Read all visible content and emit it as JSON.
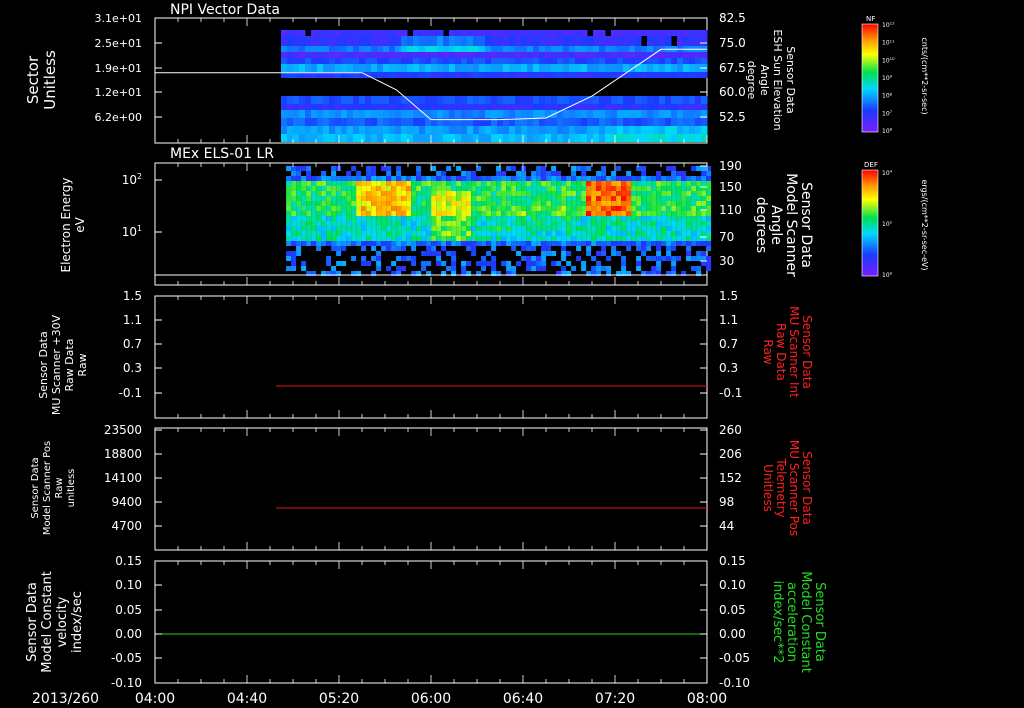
{
  "time_axis": {
    "date_label": "2013/260",
    "ticks": [
      "04:00",
      "04:40",
      "05:20",
      "06:00",
      "06:40",
      "07:20",
      "08:00"
    ],
    "range_minutes": [
      240,
      480
    ]
  },
  "panels": [
    {
      "id": "npi",
      "title": "NPI Vector Data",
      "left_label": [
        "Sector",
        "Unitless"
      ],
      "left_ticks": [
        "3.1e+01",
        "2.5e+01",
        "1.9e+01",
        "1.2e+01",
        "6.2e+00"
      ],
      "right_label": [
        "Sensor Data",
        "ESH Sun Elevation",
        "Angle",
        "degree"
      ],
      "right_ticks": [
        "82.5",
        "75.0",
        "67.5",
        "60.0",
        "52.5"
      ],
      "right_color": "#ffffff"
    },
    {
      "id": "els",
      "title": "MEx ELS-01 LR",
      "left_label": [
        "Electron Energy",
        "eV"
      ],
      "left_ticks": [
        "10",
        "10",
        "",
        ""
      ],
      "left_log_ticks": [
        {
          "base": "10",
          "exp": "2"
        },
        {
          "base": "10",
          "exp": "1"
        }
      ],
      "right_label": [
        "Sensor Data",
        "Model Scanner",
        "Angle",
        "degrees"
      ],
      "right_ticks": [
        "190",
        "150",
        "110",
        "70",
        "30"
      ],
      "right_color": "#ffffff"
    },
    {
      "id": "mu_int",
      "left_label": [
        "Sensor Data",
        "MU Scanner +30V",
        "Raw Data",
        "Raw"
      ],
      "left_ticks": [
        "1.5",
        "1.1",
        "0.7",
        "0.3",
        "-0.1"
      ],
      "right_label": [
        "Sensor Data",
        "MU Scanner Int",
        "Raw Data",
        "Raw"
      ],
      "right_ticks": [
        "1.5",
        "1.1",
        "0.7",
        "0.3",
        "-0.1"
      ],
      "right_color": "#ff2020"
    },
    {
      "id": "mu_pos",
      "left_label": [
        "Sensor Data",
        "Model Scanner Pos",
        "Raw",
        "unitless"
      ],
      "left_ticks": [
        "23500",
        "18800",
        "14100",
        "9400",
        "4700"
      ],
      "right_label": [
        "Sensor Data",
        "MU Scanner Pos",
        "Telemetry",
        "Unitless"
      ],
      "right_ticks": [
        "260",
        "206",
        "152",
        "98",
        "44"
      ],
      "right_color": "#ff2020"
    },
    {
      "id": "const",
      "left_label": [
        "Sensor Data",
        "Model Constant",
        "velocity",
        "index/sec"
      ],
      "left_ticks": [
        "0.15",
        "0.10",
        "0.05",
        "0.00",
        "-0.05",
        "-0.10"
      ],
      "right_label": [
        "Sensor Data",
        "Model Constant",
        "acceleration",
        "index/sec**2"
      ],
      "right_ticks": [
        "0.15",
        "0.10",
        "0.05",
        "0.00",
        "-0.05",
        "-0.10"
      ],
      "right_color": "#22dd22"
    }
  ],
  "colorbars": [
    {
      "label": "NF",
      "unit": "cnts/(cm**2-sr-sec)",
      "ticks": [
        {
          "base": "10",
          "exp": "12"
        },
        {
          "base": "10",
          "exp": "11"
        },
        {
          "base": "10",
          "exp": "10"
        },
        {
          "base": "10",
          "exp": "9"
        },
        {
          "base": "10",
          "exp": "8"
        },
        {
          "base": "10",
          "exp": "7"
        },
        {
          "base": "10",
          "exp": "6"
        }
      ]
    },
    {
      "label": "DEF",
      "unit": "ergs/(cm**2-sr-sec-eV)",
      "ticks": [
        {
          "base": "10",
          "exp": "4"
        },
        {
          "base": "10",
          "exp": "2"
        },
        {
          "base": "10",
          "exp": "0"
        }
      ]
    }
  ],
  "chart_data": [
    {
      "type": "heatmap",
      "title": "NPI Vector Data",
      "xlabel": "",
      "ylabel": "Sector Unitless",
      "data_start_time": "05:00",
      "overlay_series": {
        "name": "Sensor Data ESH Sun Elevation Angle",
        "units": "degree",
        "x": [
          "04:00",
          "05:30",
          "05:45",
          "06:00",
          "06:30",
          "06:50",
          "07:10",
          "07:30",
          "07:40",
          "08:00"
        ],
        "y": [
          67.5,
          67.5,
          62,
          52.5,
          52.5,
          53,
          60,
          70,
          75,
          75
        ]
      }
    },
    {
      "type": "heatmap",
      "title": "MEx ELS-01 LR",
      "ylabel": "Electron Energy eV",
      "ylim_log": [
        1,
        200
      ],
      "data_start_time": "04:57",
      "overlay_series": {
        "name": "Sensor Data Model Scanner Angle",
        "units": "degrees",
        "x": [
          "04:00",
          "08:00"
        ],
        "y": [
          10,
          10
        ]
      }
    },
    {
      "type": "line",
      "series": [
        {
          "name": "Sensor Data MU Scanner Int Raw Data",
          "x": [
            "04:50",
            "08:00"
          ],
          "y": [
            0,
            0
          ]
        }
      ],
      "ylim": [
        -0.2,
        1.5
      ]
    },
    {
      "type": "line",
      "series": [
        {
          "name": "Sensor Data MU Scanner Pos Telemetry",
          "x": [
            "04:50",
            "08:00"
          ],
          "y": [
            87,
            87
          ]
        }
      ],
      "ylim": [
        0,
        260
      ]
    },
    {
      "type": "line",
      "series": [
        {
          "name": "Sensor Data Model Constant acceleration",
          "x": [
            "04:00",
            "08:00"
          ],
          "y": [
            0.0,
            0.0
          ]
        }
      ],
      "ylim": [
        -0.1,
        0.15
      ]
    }
  ]
}
